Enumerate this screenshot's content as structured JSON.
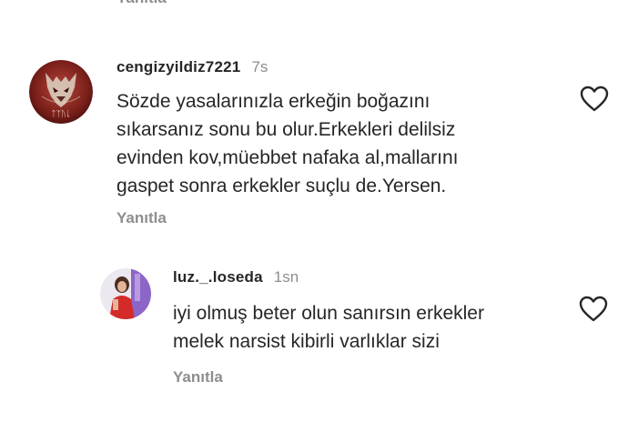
{
  "top": {
    "reply_label": "Yanıtla"
  },
  "comments": [
    {
      "username": "cengizyildiz7221",
      "timestamp": "7s",
      "text": "Sözde yasalarınızla erkeğin boğazını\nsıkarsanız sonu bu olur.Erkekleri delilsiz\nevinden kov,müebbet nafaka al,mallarını\ngaspet sonra erkekler suçlu de.Yersen.",
      "reply_label": "Yanıtla",
      "avatar_text": "ᛏᛉᚢᚳ",
      "like_icon": "heart-outline-icon"
    },
    {
      "username": "luz._.loseda",
      "timestamp": "1sn",
      "text": "iyi olmuş beter olun sanırsın erkekler\nmelek narsist kibirli varlıklar sizi",
      "reply_label": "Yanıtla",
      "like_icon": "heart-outline-icon"
    }
  ],
  "colors": {
    "text_primary": "#262626",
    "text_secondary": "#8e8e8e",
    "avatar1_bg": "#7a1f1a",
    "avatar2_accent": "#d42a2a"
  }
}
